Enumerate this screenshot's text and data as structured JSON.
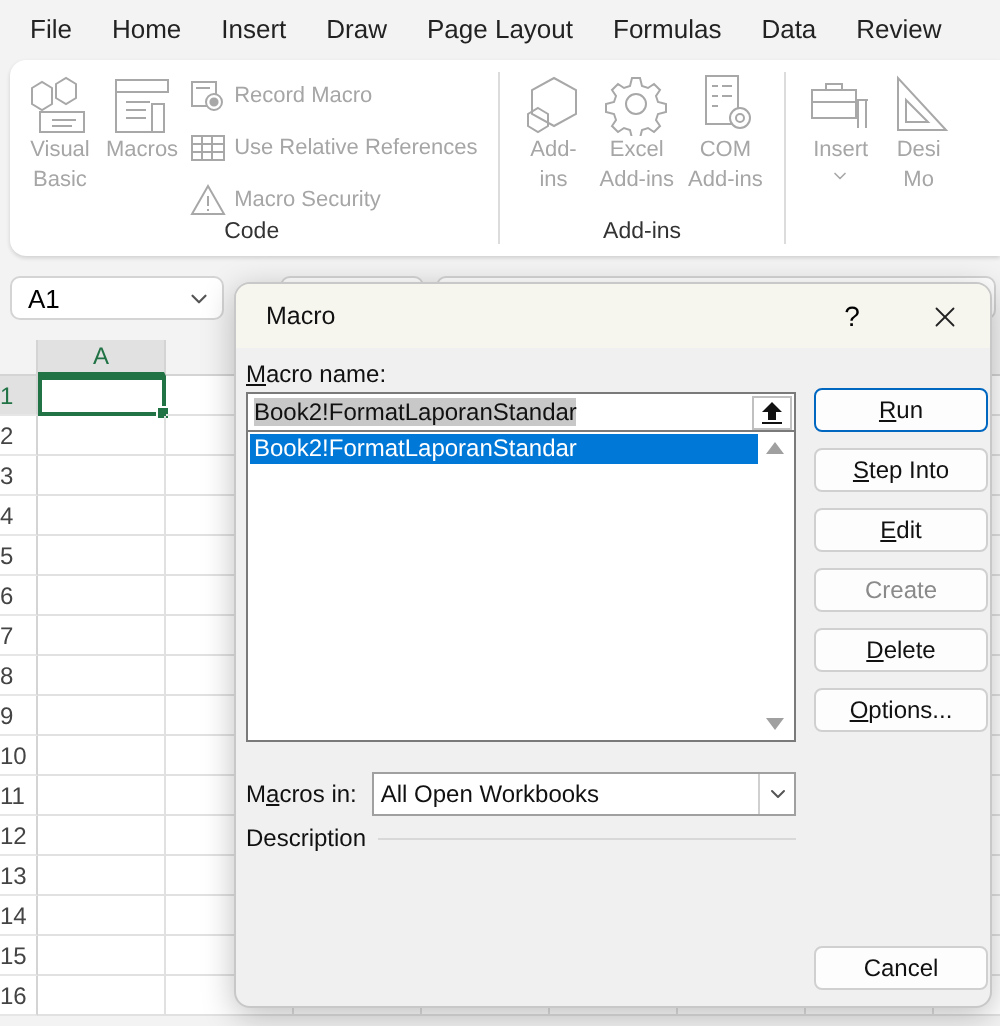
{
  "menu": [
    {
      "label": "File"
    },
    {
      "label": "Home"
    },
    {
      "label": "Insert"
    },
    {
      "label": "Draw"
    },
    {
      "label": "Page Layout"
    },
    {
      "label": "Formulas"
    },
    {
      "label": "Data"
    },
    {
      "label": "Review"
    }
  ],
  "ribbon": {
    "groups": [
      {
        "name": "Code",
        "items": [
          {
            "kind": "large",
            "label": "Visual\nBasic",
            "disabled": true
          },
          {
            "kind": "large",
            "label": "Macros",
            "disabled": true
          },
          {
            "kind": "small",
            "label": "Record Macro",
            "disabled": true
          },
          {
            "kind": "small",
            "label": "Use Relative References",
            "disabled": true
          },
          {
            "kind": "small",
            "label": "Macro Security",
            "disabled": true
          }
        ]
      },
      {
        "name": "Add-ins",
        "items": [
          {
            "kind": "large",
            "label": "Add-\nins",
            "disabled": true
          },
          {
            "kind": "large",
            "label": "Excel\nAdd-ins",
            "disabled": true
          },
          {
            "kind": "large",
            "label": "COM\nAdd-ins",
            "disabled": true
          }
        ]
      },
      {
        "items": [
          {
            "kind": "dropdown",
            "label": "Insert",
            "disabled": true
          },
          {
            "kind": "large",
            "label": "Desi\nMo",
            "disabled": true
          }
        ]
      }
    ]
  },
  "sheet": {
    "name_box": "A1",
    "columns": [
      {
        "label": "A",
        "selected": true
      }
    ],
    "rows": [
      {
        "label": "1",
        "selected": true
      },
      {
        "label": "2",
        "selected": false
      },
      {
        "label": "3",
        "selected": false
      },
      {
        "label": "4",
        "selected": false
      },
      {
        "label": "5",
        "selected": false
      },
      {
        "label": "6",
        "selected": false
      },
      {
        "label": "7",
        "selected": false
      },
      {
        "label": "8",
        "selected": false
      },
      {
        "label": "9",
        "selected": false
      },
      {
        "label": "10",
        "selected": false
      },
      {
        "label": "11",
        "selected": false
      },
      {
        "label": "12",
        "selected": false
      },
      {
        "label": "13",
        "selected": false
      },
      {
        "label": "14",
        "selected": false
      },
      {
        "label": "15",
        "selected": false
      },
      {
        "label": "16",
        "selected": false
      }
    ]
  },
  "dialog": {
    "title": "Macro",
    "help": "?",
    "name_label": {
      "key": "M",
      "after": "acro name:"
    },
    "name_value": "Book2!FormatLaporanStandar",
    "macros": [
      {
        "name": "Book2!FormatLaporanStandar",
        "selected": true
      }
    ],
    "macros_in_label": {
      "before": "M",
      "key": "a",
      "after": "cros in:"
    },
    "macros_in_value": "All Open Workbooks",
    "description_label": "Description",
    "buttons": [
      {
        "key": "R",
        "after": "un",
        "disabled": false,
        "default": true
      },
      {
        "key": "S",
        "after": "tep Into",
        "disabled": false,
        "default": false
      },
      {
        "key": "E",
        "after": "dit",
        "disabled": false,
        "default": false
      },
      {
        "after": "Create",
        "disabled": true,
        "default": false
      },
      {
        "key": "D",
        "after": "elete",
        "disabled": false,
        "default": false
      },
      {
        "key": "O",
        "after": "ptions...",
        "disabled": false,
        "default": false
      },
      {
        "after": "Cancel",
        "disabled": false,
        "default": false
      }
    ]
  }
}
